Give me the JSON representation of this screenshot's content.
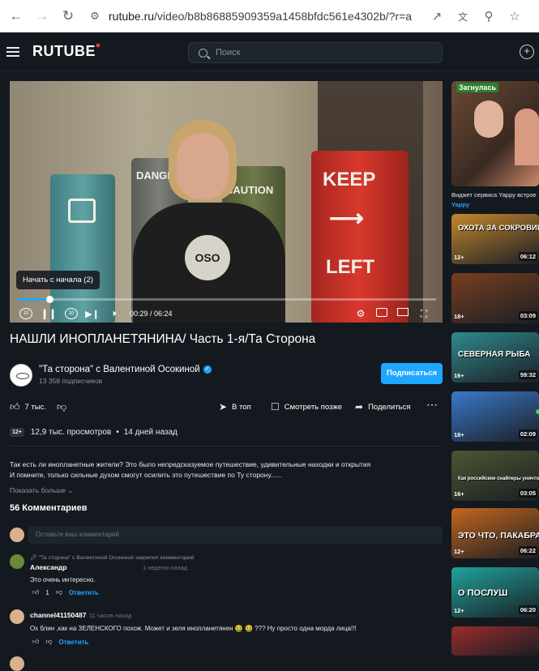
{
  "browser": {
    "url_host": "rutube.ru",
    "url_path": "/video/b8b86885909359a1458bfdc561e4302b/?r=a"
  },
  "header": {
    "logo": "RUTUBE",
    "search_placeholder": "Поиск"
  },
  "player": {
    "barrel_texts": [
      "DANGER",
      "CAUTION",
      "KEEP",
      "LEFT"
    ],
    "shirt_logo": "OSO",
    "tooltip": "Начать с начала (2)",
    "time": "00:29 / 06:24",
    "progress": 0.075,
    "skip_back_label": "10",
    "skip_forward_label": "10"
  },
  "video": {
    "title": "НАШЛИ ИНОПЛАНЕТЯНИНА/ Часть 1-я/Та Сторона",
    "channel_name": "\"Та сторона\" с Валентиной Осокиной",
    "subscribers": "13 358 подписчиков",
    "subscribe_label": "Подписаться",
    "likes": "7 тыс.",
    "to_top": "В топ",
    "watch_later": "Смотреть позже",
    "share": "Поделиться",
    "age": "12+",
    "views": "12,9 тыс. просмотров",
    "published": "14 дней назад",
    "description_line1": "Так есть ли инопланетные жители? Это было непредсказуемое путешествие, удивительные находки и открытия",
    "description_line2": "И помните, только сильные духом смогут осилить это путешествие по Ту сторону......",
    "show_more": "Показать больше"
  },
  "comments": {
    "count_label": "56 Комментариев",
    "input_placeholder": "Оставьте ваш комментарий",
    "items": [
      {
        "pinned": "\"Та сторона\" с Валентиной Осокиной закрепил комментарий",
        "author": "Александр",
        "time": "1 неделю назад",
        "text": "Это очень интересно.",
        "likes": "1",
        "reply": "Ответить"
      },
      {
        "author": "channel41150487",
        "time": "11 часов назад",
        "text": "Ох блин ,как на ЗЕЛЕНСКОГО похож. Может и зеля инопланетянен 🤮 🤮 ??? Ну просто одна морда лица!!!",
        "reply": "Ответить"
      }
    ]
  },
  "sidebar": {
    "ad_caption": "Загнулась",
    "ad_title": "Виджет сервиса Yappy встрое",
    "ad_source": "Yappy",
    "videos": [
      {
        "age": "12+",
        "duration": "06:12",
        "caption": "ОХОТА ЗА СОКРОВИЩАМИ ПОД ВОДОЙ",
        "color": "#c5872c"
      },
      {
        "age": "18+",
        "duration": "03:09",
        "caption": "",
        "color": "#7a3e1e"
      },
      {
        "age": "16+",
        "duration": "59:32",
        "caption": "СЕВЕРНАЯ РЫБА",
        "color": "#2e8a8e"
      },
      {
        "age": "18+",
        "duration": "02:09",
        "caption": "",
        "color": "#3a79c9"
      },
      {
        "age": "16+",
        "duration": "03:05",
        "caption": "Как российские снайперы уничтожают ВСУшников",
        "color": "#4d5631"
      },
      {
        "age": "12+",
        "duration": "06:22",
        "caption": "ЭТО ЧТО, ПАКАБРА?",
        "color": "#c4661d"
      },
      {
        "age": "12+",
        "duration": "06:20",
        "caption": "О ПОСЛУШ",
        "color": "#1fa39b"
      },
      {
        "age": "",
        "duration": "",
        "caption": "",
        "color": "#9b2b2b"
      }
    ]
  }
}
